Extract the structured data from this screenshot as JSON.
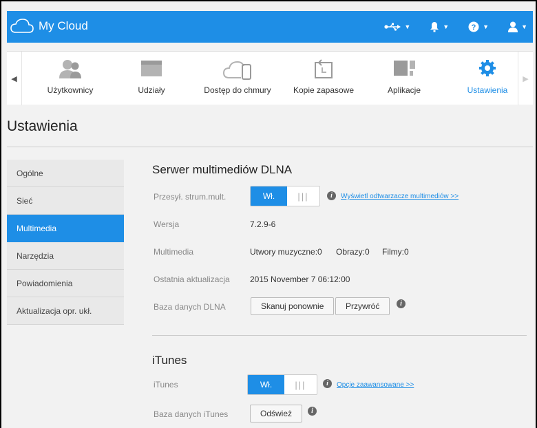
{
  "app": {
    "title": "My Cloud"
  },
  "topbar": {
    "icons": [
      "usb-icon",
      "bell-icon",
      "help-icon",
      "user-icon"
    ]
  },
  "nav": {
    "items": [
      {
        "label": "Użytkownicy",
        "icon": "users-icon"
      },
      {
        "label": "Udziały",
        "icon": "folder-icon"
      },
      {
        "label": "Dostęp do chmury",
        "icon": "cloud-device-icon"
      },
      {
        "label": "Kopie zapasowe",
        "icon": "backup-icon"
      },
      {
        "label": "Aplikacje",
        "icon": "apps-icon"
      },
      {
        "label": "Ustawienia",
        "icon": "gear-icon",
        "active": true
      }
    ]
  },
  "page": {
    "title": "Ustawienia"
  },
  "sidebar": {
    "items": [
      {
        "label": "Ogólne"
      },
      {
        "label": "Sieć"
      },
      {
        "label": "Multimedia",
        "active": true
      },
      {
        "label": "Narzędzia"
      },
      {
        "label": "Powiadomienia"
      },
      {
        "label": "Aktualizacja opr. ukł."
      }
    ]
  },
  "dlna": {
    "title": "Serwer multimediów DLNA",
    "stream_label": "Przesył. strum.mult.",
    "toggle_on": "Wł.",
    "toggle_off": "|||",
    "players_link": "Wyświetl odtwarzacze multimediów >>",
    "version_label": "Wersja",
    "version_value": "7.2.9-6",
    "media_label": "Multimedia",
    "music": "Utwory muzyczne:0",
    "images": "Obrazy:0",
    "movies": "Filmy:0",
    "last_update_label": "Ostatnia aktualizacja",
    "last_update_value": "2015 November 7 06:12:00",
    "db_label": "Baza danych DLNA",
    "rescan_button": "Skanuj ponownie",
    "restore_button": "Przywróć"
  },
  "itunes": {
    "title": "iTunes",
    "label": "iTunes",
    "toggle_on": "Wł.",
    "toggle_off": "|||",
    "advanced_link": "Opcje zaawansowane >>",
    "db_label": "Baza danych iTunes",
    "refresh_button": "Odśwież"
  },
  "colors": {
    "accent": "#1e8ee6",
    "background": "#f2f2f2"
  }
}
